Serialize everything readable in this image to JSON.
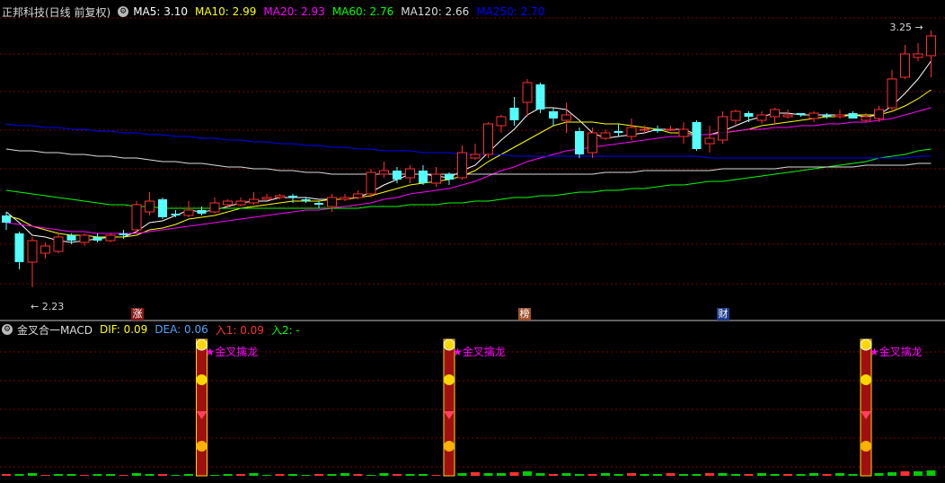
{
  "title": "正邦科技(日线 前复权)",
  "ma_legend": [
    {
      "label": "MA5: 3.10",
      "color": "#ffffff"
    },
    {
      "label": "MA10: 2.99",
      "color": "#ffff00"
    },
    {
      "label": "MA20: 2.93",
      "color": "#ff00ff"
    },
    {
      "label": "MA60: 2.76",
      "color": "#00ff00"
    },
    {
      "label": "MA120: 2.66",
      "color": "#dcdcdc"
    },
    {
      "label": "MA250: 2.70",
      "color": "#0000ff"
    }
  ],
  "high_label": "3.25",
  "low_label": "2.23",
  "badges": [
    {
      "text": "涨",
      "bg": "#8b1a1a"
    },
    {
      "text": "榜",
      "bg": "#a0522d"
    },
    {
      "text": "财",
      "bg": "#1e3c8c"
    }
  ],
  "indicator": {
    "name": "金叉合一MACD",
    "items": [
      {
        "label": "DIF: 0.09",
        "color": "#ffff00"
      },
      {
        "label": "DEA: 0.06",
        "color": "#4da6ff"
      },
      {
        "label": "入1: 0.09",
        "color": "#ff3333"
      },
      {
        "label": "入2: -",
        "color": "#00ff00"
      }
    ],
    "signal_label": "★金叉擒龙"
  },
  "colors": {
    "up": "#ff3030",
    "down": "#54ffff",
    "grid": "#800000",
    "signal": "#ff00ff"
  },
  "chart_data": {
    "type": "candlestick",
    "y_range": [
      2.23,
      3.25
    ],
    "candles": [
      [
        2.7,
        2.66,
        2.72,
        2.62
      ],
      [
        2.6,
        2.44,
        2.61,
        2.4
      ],
      [
        2.44,
        2.56,
        2.58,
        2.3
      ],
      [
        2.49,
        2.53,
        2.55,
        2.46
      ],
      [
        2.5,
        2.58,
        2.6,
        2.49
      ],
      [
        2.59,
        2.56,
        2.6,
        2.54
      ],
      [
        2.55,
        2.59,
        2.6,
        2.53
      ],
      [
        2.58,
        2.56,
        2.6,
        2.55
      ],
      [
        2.56,
        2.59,
        2.6,
        2.55
      ],
      [
        2.6,
        2.59,
        2.62,
        2.57
      ],
      [
        2.62,
        2.76,
        2.78,
        2.6
      ],
      [
        2.72,
        2.78,
        2.83,
        2.7
      ],
      [
        2.79,
        2.69,
        2.8,
        2.68
      ],
      [
        2.71,
        2.7,
        2.73,
        2.69
      ],
      [
        2.7,
        2.73,
        2.78,
        2.69
      ],
      [
        2.73,
        2.71,
        2.75,
        2.7
      ],
      [
        2.72,
        2.77,
        2.8,
        2.71
      ],
      [
        2.76,
        2.78,
        2.79,
        2.74
      ],
      [
        2.76,
        2.78,
        2.8,
        2.75
      ],
      [
        2.77,
        2.79,
        2.83,
        2.76
      ],
      [
        2.79,
        2.8,
        2.82,
        2.79
      ],
      [
        2.8,
        2.81,
        2.82,
        2.79
      ],
      [
        2.81,
        2.8,
        2.82,
        2.77
      ],
      [
        2.79,
        2.78,
        2.8,
        2.77
      ],
      [
        2.77,
        2.76,
        2.78,
        2.74
      ],
      [
        2.75,
        2.8,
        2.82,
        2.72
      ],
      [
        2.79,
        2.8,
        2.82,
        2.78
      ],
      [
        2.8,
        2.82,
        2.84,
        2.79
      ],
      [
        2.82,
        2.94,
        2.96,
        2.8
      ],
      [
        2.93,
        2.95,
        3.0,
        2.91
      ],
      [
        2.95,
        2.9,
        2.97,
        2.88
      ],
      [
        2.91,
        2.96,
        2.98,
        2.88
      ],
      [
        2.95,
        2.88,
        2.98,
        2.87
      ],
      [
        2.88,
        2.93,
        2.97,
        2.86
      ],
      [
        2.93,
        2.9,
        2.94,
        2.87
      ],
      [
        2.91,
        3.05,
        3.09,
        2.9
      ],
      [
        3.02,
        3.04,
        3.1,
        3.01
      ],
      [
        3.04,
        3.21,
        3.22,
        3.02
      ],
      [
        3.2,
        3.25,
        3.26,
        3.16
      ],
      [
        3.3,
        3.23,
        3.36,
        3.2
      ],
      [
        3.33,
        3.44,
        3.46,
        3.25
      ],
      [
        3.43,
        3.29,
        3.44,
        3.27
      ],
      [
        3.28,
        3.24,
        3.3,
        3.2
      ],
      [
        3.23,
        3.26,
        3.33,
        3.16
      ],
      [
        3.17,
        3.04,
        3.19,
        3.02
      ],
      [
        3.05,
        3.16,
        3.19,
        3.02
      ],
      [
        3.13,
        3.16,
        3.18,
        3.12
      ],
      [
        3.17,
        3.16,
        3.21,
        3.14
      ],
      [
        3.14,
        3.19,
        3.24,
        3.12
      ],
      [
        3.18,
        3.18,
        3.2,
        3.16
      ],
      [
        3.18,
        3.17,
        3.2,
        3.16
      ],
      [
        3.18,
        3.18,
        3.2,
        3.17
      ],
      [
        3.14,
        3.18,
        3.22,
        3.1
      ],
      [
        3.22,
        3.07,
        3.23,
        3.06
      ],
      [
        3.1,
        3.13,
        3.2,
        3.05
      ],
      [
        3.12,
        3.25,
        3.28,
        3.1
      ],
      [
        3.23,
        3.28,
        3.29,
        3.2
      ],
      [
        3.27,
        3.25,
        3.28,
        3.22
      ],
      [
        3.23,
        3.26,
        3.28,
        3.21
      ],
      [
        3.25,
        3.29,
        3.3,
        3.21
      ],
      [
        3.25,
        3.26,
        3.29,
        3.24
      ],
      [
        3.27,
        3.26,
        3.27,
        3.25
      ],
      [
        3.24,
        3.27,
        3.28,
        3.22
      ],
      [
        3.26,
        3.25,
        3.27,
        3.24
      ],
      [
        3.25,
        3.26,
        3.29,
        3.24
      ],
      [
        3.27,
        3.24,
        3.28,
        3.24
      ],
      [
        3.23,
        3.25,
        3.27,
        3.22
      ],
      [
        3.24,
        3.29,
        3.31,
        3.22
      ],
      [
        3.3,
        3.46,
        3.51,
        3.28
      ],
      [
        3.47,
        3.6,
        3.65,
        3.46
      ],
      [
        3.58,
        3.6,
        3.66,
        3.56
      ],
      [
        3.59,
        3.7,
        3.73,
        3.47
      ]
    ],
    "ma_lines": [
      {
        "name": "MA5",
        "color": "#ffffff",
        "values": [
          2.72,
          2.66,
          2.59,
          2.58,
          2.56,
          2.55,
          2.56,
          2.57,
          2.58,
          2.58,
          2.61,
          2.66,
          2.67,
          2.7,
          2.73,
          2.72,
          2.73,
          2.75,
          2.77,
          2.78,
          2.78,
          2.8,
          2.8,
          2.8,
          2.79,
          2.79,
          2.79,
          2.8,
          2.83,
          2.87,
          2.9,
          2.93,
          2.93,
          2.92,
          2.91,
          2.95,
          2.98,
          3.05,
          3.12,
          3.18,
          3.26,
          3.3,
          3.3,
          3.29,
          3.23,
          3.16,
          3.13,
          3.14,
          3.15,
          3.16,
          3.18,
          3.18,
          3.18,
          3.15,
          3.15,
          3.17,
          3.2,
          3.23,
          3.25,
          3.27,
          3.27,
          3.26,
          3.26,
          3.26,
          3.26,
          3.26,
          3.25,
          3.26,
          3.31,
          3.38,
          3.46,
          3.56
        ]
      },
      {
        "name": "MA10",
        "color": "#ffff00",
        "values": [
          2.7,
          2.68,
          2.64,
          2.62,
          2.6,
          2.59,
          2.59,
          2.58,
          2.58,
          2.58,
          2.59,
          2.62,
          2.63,
          2.65,
          2.68,
          2.69,
          2.7,
          2.72,
          2.74,
          2.75,
          2.76,
          2.77,
          2.78,
          2.78,
          2.78,
          2.79,
          2.79,
          2.8,
          2.81,
          2.83,
          2.85,
          2.87,
          2.88,
          2.89,
          2.9,
          2.92,
          2.95,
          3.0,
          3.04,
          3.08,
          3.12,
          3.16,
          3.2,
          3.22,
          3.22,
          3.22,
          3.21,
          3.21,
          3.2,
          3.19,
          3.18,
          3.16,
          3.16,
          3.15,
          3.15,
          3.16,
          3.17,
          3.18,
          3.2,
          3.21,
          3.22,
          3.23,
          3.24,
          3.25,
          3.25,
          3.26,
          3.26,
          3.26,
          3.28,
          3.31,
          3.35,
          3.4
        ]
      },
      {
        "name": "MA20",
        "color": "#ff00ff",
        "values": [
          2.66,
          2.65,
          2.64,
          2.63,
          2.62,
          2.61,
          2.61,
          2.6,
          2.6,
          2.6,
          2.6,
          2.61,
          2.62,
          2.63,
          2.64,
          2.65,
          2.66,
          2.67,
          2.68,
          2.69,
          2.7,
          2.71,
          2.72,
          2.73,
          2.73,
          2.74,
          2.75,
          2.76,
          2.77,
          2.79,
          2.8,
          2.82,
          2.83,
          2.84,
          2.85,
          2.87,
          2.89,
          2.92,
          2.95,
          2.97,
          3.0,
          3.02,
          3.04,
          3.06,
          3.07,
          3.08,
          3.09,
          3.1,
          3.11,
          3.12,
          3.13,
          3.14,
          3.14,
          3.15,
          3.15,
          3.16,
          3.17,
          3.18,
          3.18,
          3.19,
          3.19,
          3.2,
          3.2,
          3.21,
          3.21,
          3.22,
          3.22,
          3.23,
          3.24,
          3.26,
          3.28,
          3.3
        ]
      },
      {
        "name": "MA60",
        "color": "#00ff00",
        "values": [
          2.84,
          2.83,
          2.82,
          2.81,
          2.8,
          2.79,
          2.78,
          2.77,
          2.76,
          2.76,
          2.75,
          2.75,
          2.74,
          2.74,
          2.74,
          2.74,
          2.74,
          2.74,
          2.74,
          2.74,
          2.74,
          2.74,
          2.74,
          2.74,
          2.74,
          2.74,
          2.74,
          2.74,
          2.75,
          2.75,
          2.75,
          2.76,
          2.76,
          2.76,
          2.77,
          2.77,
          2.78,
          2.78,
          2.79,
          2.8,
          2.8,
          2.81,
          2.81,
          2.82,
          2.83,
          2.83,
          2.84,
          2.84,
          2.85,
          2.85,
          2.86,
          2.87,
          2.87,
          2.88,
          2.89,
          2.89,
          2.9,
          2.91,
          2.92,
          2.93,
          2.94,
          2.95,
          2.96,
          2.97,
          2.98,
          2.99,
          3.0,
          3.02,
          3.03,
          3.04,
          3.06,
          3.07
        ]
      },
      {
        "name": "MA120",
        "color": "#dcdcdc",
        "values": [
          3.07,
          3.06,
          3.06,
          3.05,
          3.05,
          3.04,
          3.04,
          3.03,
          3.03,
          3.02,
          3.02,
          3.01,
          3.0,
          3.0,
          2.99,
          2.99,
          2.98,
          2.97,
          2.97,
          2.96,
          2.96,
          2.95,
          2.95,
          2.94,
          2.94,
          2.93,
          2.93,
          2.93,
          2.93,
          2.93,
          2.93,
          2.93,
          2.93,
          2.93,
          2.93,
          2.93,
          2.93,
          2.93,
          2.93,
          2.93,
          2.93,
          2.93,
          2.93,
          2.93,
          2.93,
          2.93,
          2.94,
          2.94,
          2.94,
          2.95,
          2.95,
          2.95,
          2.95,
          2.95,
          2.95,
          2.96,
          2.96,
          2.96,
          2.96,
          2.96,
          2.97,
          2.97,
          2.97,
          2.97,
          2.97,
          2.97,
          2.98,
          2.98,
          2.98,
          2.98,
          2.99,
          2.99
        ]
      },
      {
        "name": "MA250",
        "color": "#0000ff",
        "values": [
          3.21,
          3.2,
          3.2,
          3.19,
          3.19,
          3.18,
          3.18,
          3.17,
          3.17,
          3.16,
          3.16,
          3.15,
          3.15,
          3.14,
          3.14,
          3.13,
          3.13,
          3.12,
          3.12,
          3.11,
          3.11,
          3.1,
          3.1,
          3.09,
          3.09,
          3.08,
          3.08,
          3.07,
          3.07,
          3.06,
          3.06,
          3.06,
          3.05,
          3.05,
          3.05,
          3.04,
          3.04,
          3.04,
          3.04,
          3.03,
          3.03,
          3.03,
          3.03,
          3.03,
          3.03,
          3.03,
          3.03,
          3.03,
          3.03,
          3.03,
          3.03,
          3.03,
          3.03,
          3.03,
          3.02,
          3.02,
          3.02,
          3.02,
          3.02,
          3.02,
          3.02,
          3.02,
          3.02,
          3.02,
          3.02,
          3.02,
          3.02,
          3.02,
          3.02,
          3.02,
          3.03,
          3.03
        ]
      }
    ],
    "signal_bars_at": [
      15,
      34,
      66
    ],
    "volume": [
      2,
      2,
      3,
      1,
      2,
      2,
      1,
      2,
      2,
      1,
      3,
      2,
      2,
      1,
      2,
      2,
      1,
      2,
      2,
      3,
      1,
      2,
      2,
      1,
      2,
      2,
      3,
      2,
      1,
      3,
      2,
      2,
      2,
      1,
      3,
      3,
      4,
      3,
      3,
      4,
      5,
      3,
      2,
      3,
      2,
      2,
      3,
      2,
      3,
      2,
      2,
      3,
      2,
      2,
      3,
      3,
      2,
      2,
      3,
      2,
      2,
      2,
      3,
      2,
      3,
      2,
      2,
      3,
      4,
      5,
      5,
      6
    ]
  }
}
